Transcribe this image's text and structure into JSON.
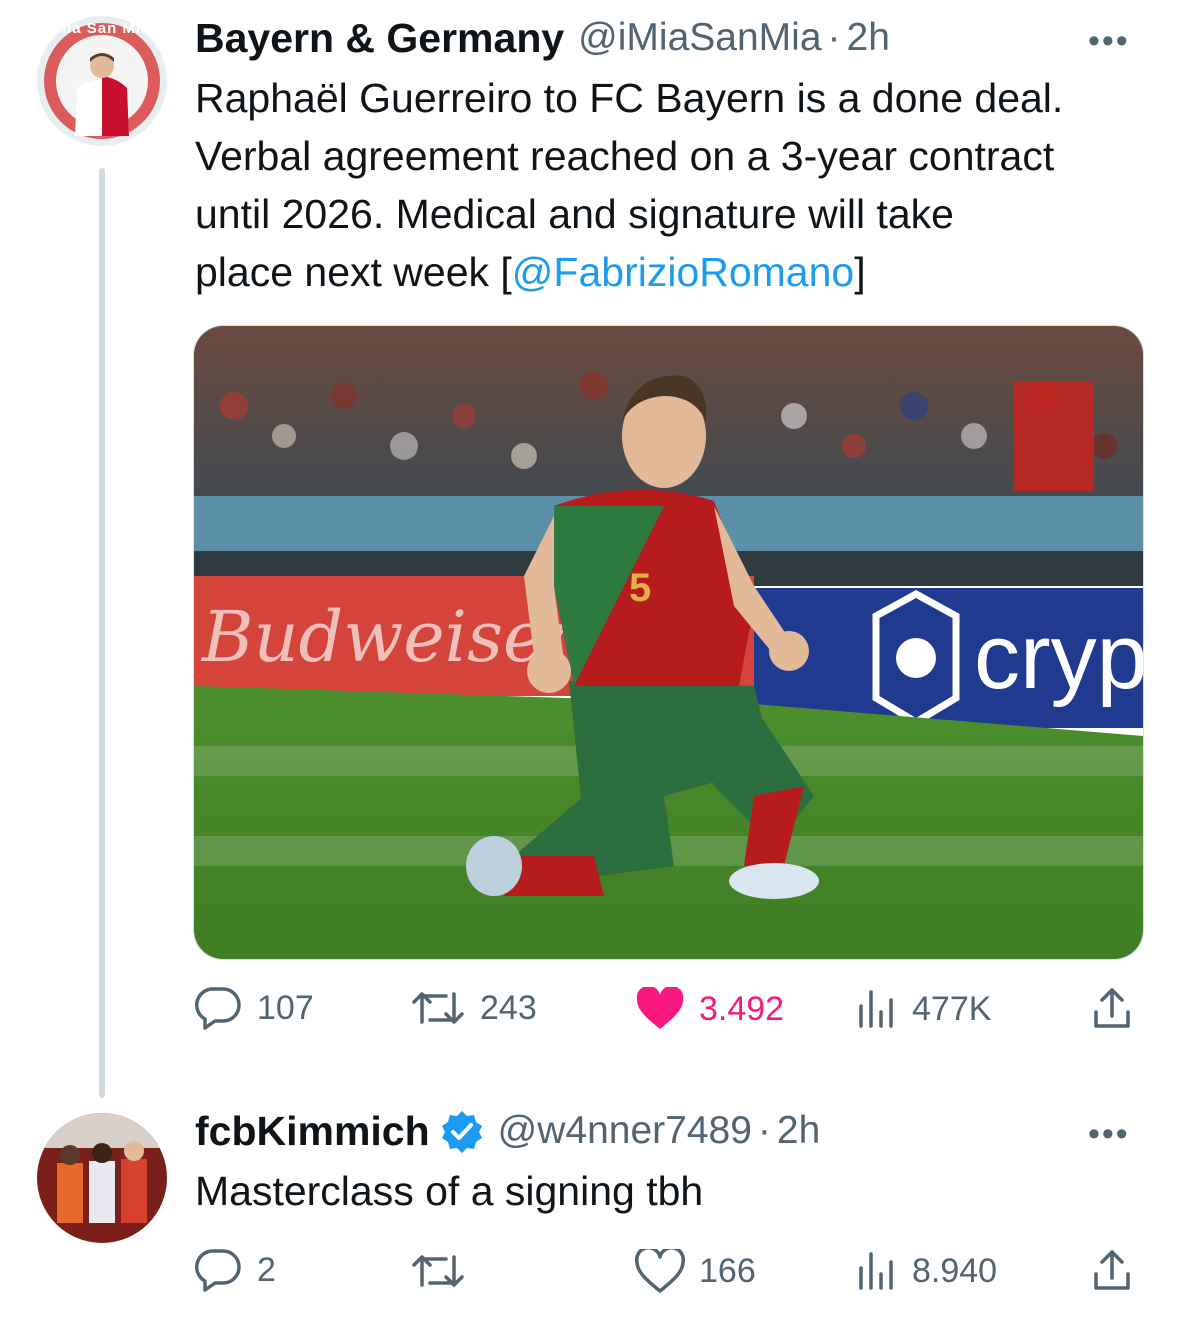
{
  "tweet1": {
    "author_name": "Bayern & Germany",
    "handle": "@iMiaSanMia",
    "separator": "·",
    "time": "2h",
    "text_lines": [
      "Raphaël Guerreiro to FC Bayern is a done deal.",
      "Verbal agreement reached on a 3-year contract",
      "until 2026. Medical and signature will take"
    ],
    "text_last_prefix": "place next week [",
    "mention": "@FabrizioRomano",
    "text_last_suffix": "]",
    "more_label": "•••",
    "avatar_text": "Mia San Mia",
    "media": {
      "banner_left": "Budweiser",
      "banner_right": "cryp",
      "jersey_number": "5"
    },
    "replies": "107",
    "retweets": "243",
    "likes": "3.492",
    "views": "477K",
    "liked": true
  },
  "tweet2": {
    "author_name": "fcbKimmich",
    "handle": "@w4nner7489",
    "separator": "·",
    "time": "2h",
    "verified": true,
    "text": "Masterclass of a signing tbh",
    "more_label": "•••",
    "replies": "2",
    "retweets": "",
    "likes": "166",
    "views": "8.940",
    "liked": false
  },
  "icons": [
    "reply-icon",
    "retweet-icon",
    "heart-icon",
    "views-icon",
    "share-icon",
    "verified-badge-icon",
    "more-icon"
  ],
  "colors": {
    "text": "#0f1419",
    "secondary": "#536471",
    "link": "#1d9bf0",
    "like": "#f91880",
    "thread_line": "#cfd9de"
  }
}
